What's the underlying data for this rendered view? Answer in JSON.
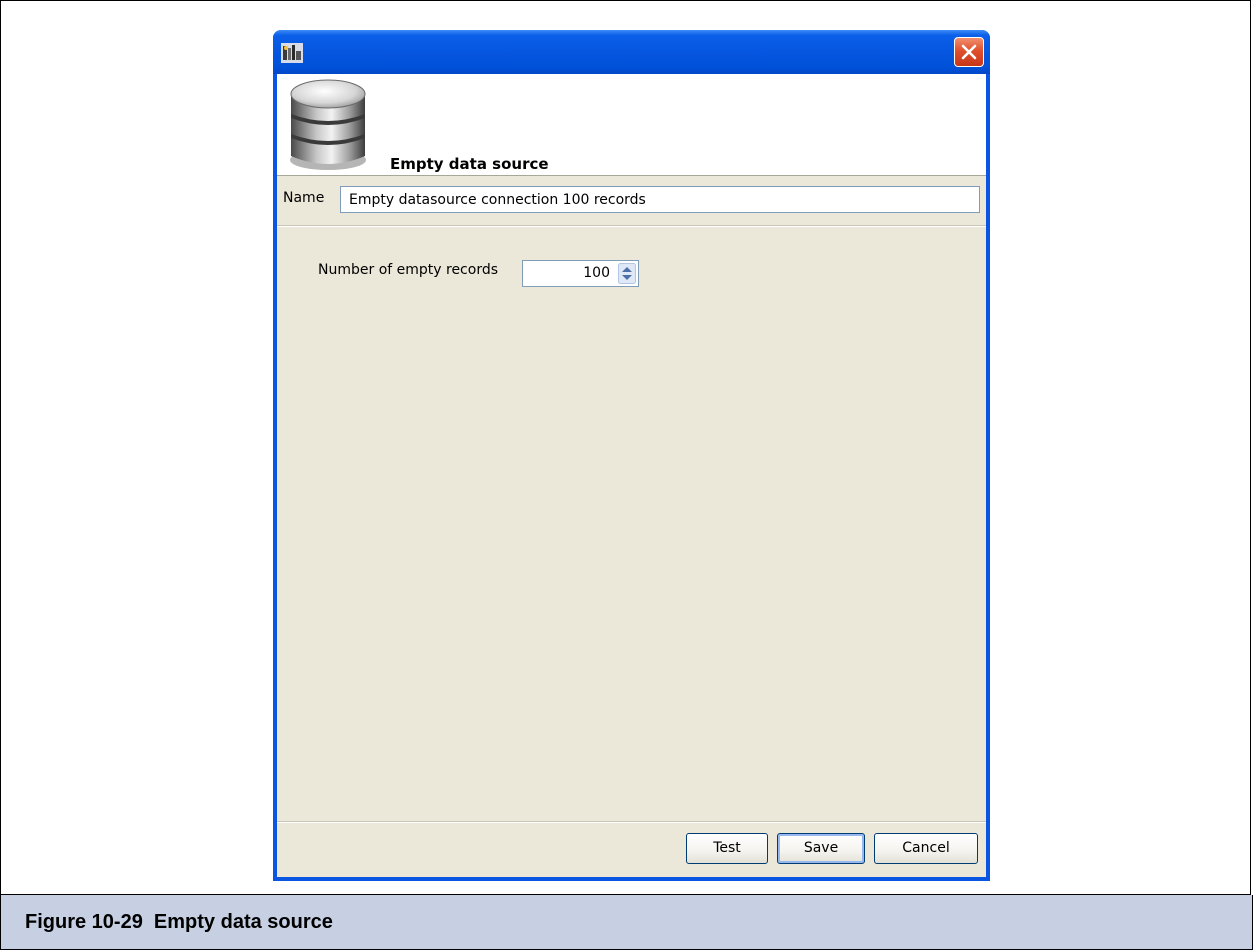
{
  "dialog": {
    "header_title": "Empty data source",
    "name_label": "Name",
    "name_value": "Empty datasource connection 100 records",
    "records_label": "Number of empty records",
    "records_value": "100"
  },
  "buttons": {
    "test_label": "Test",
    "save_label": "Save",
    "cancel_label": "Cancel"
  },
  "caption": {
    "text": "Figure 10-29  Empty data source"
  },
  "icons": {
    "app": "app-icon",
    "close": "close-icon",
    "database": "database-icon",
    "spinner": "spinner-arrows-icon"
  },
  "colors": {
    "titlebar": "#0656e0",
    "client_bg": "#ebe8d9",
    "caption_bg": "#c6d0e2",
    "close_button": "#e0502c",
    "button_border": "#003c74"
  }
}
